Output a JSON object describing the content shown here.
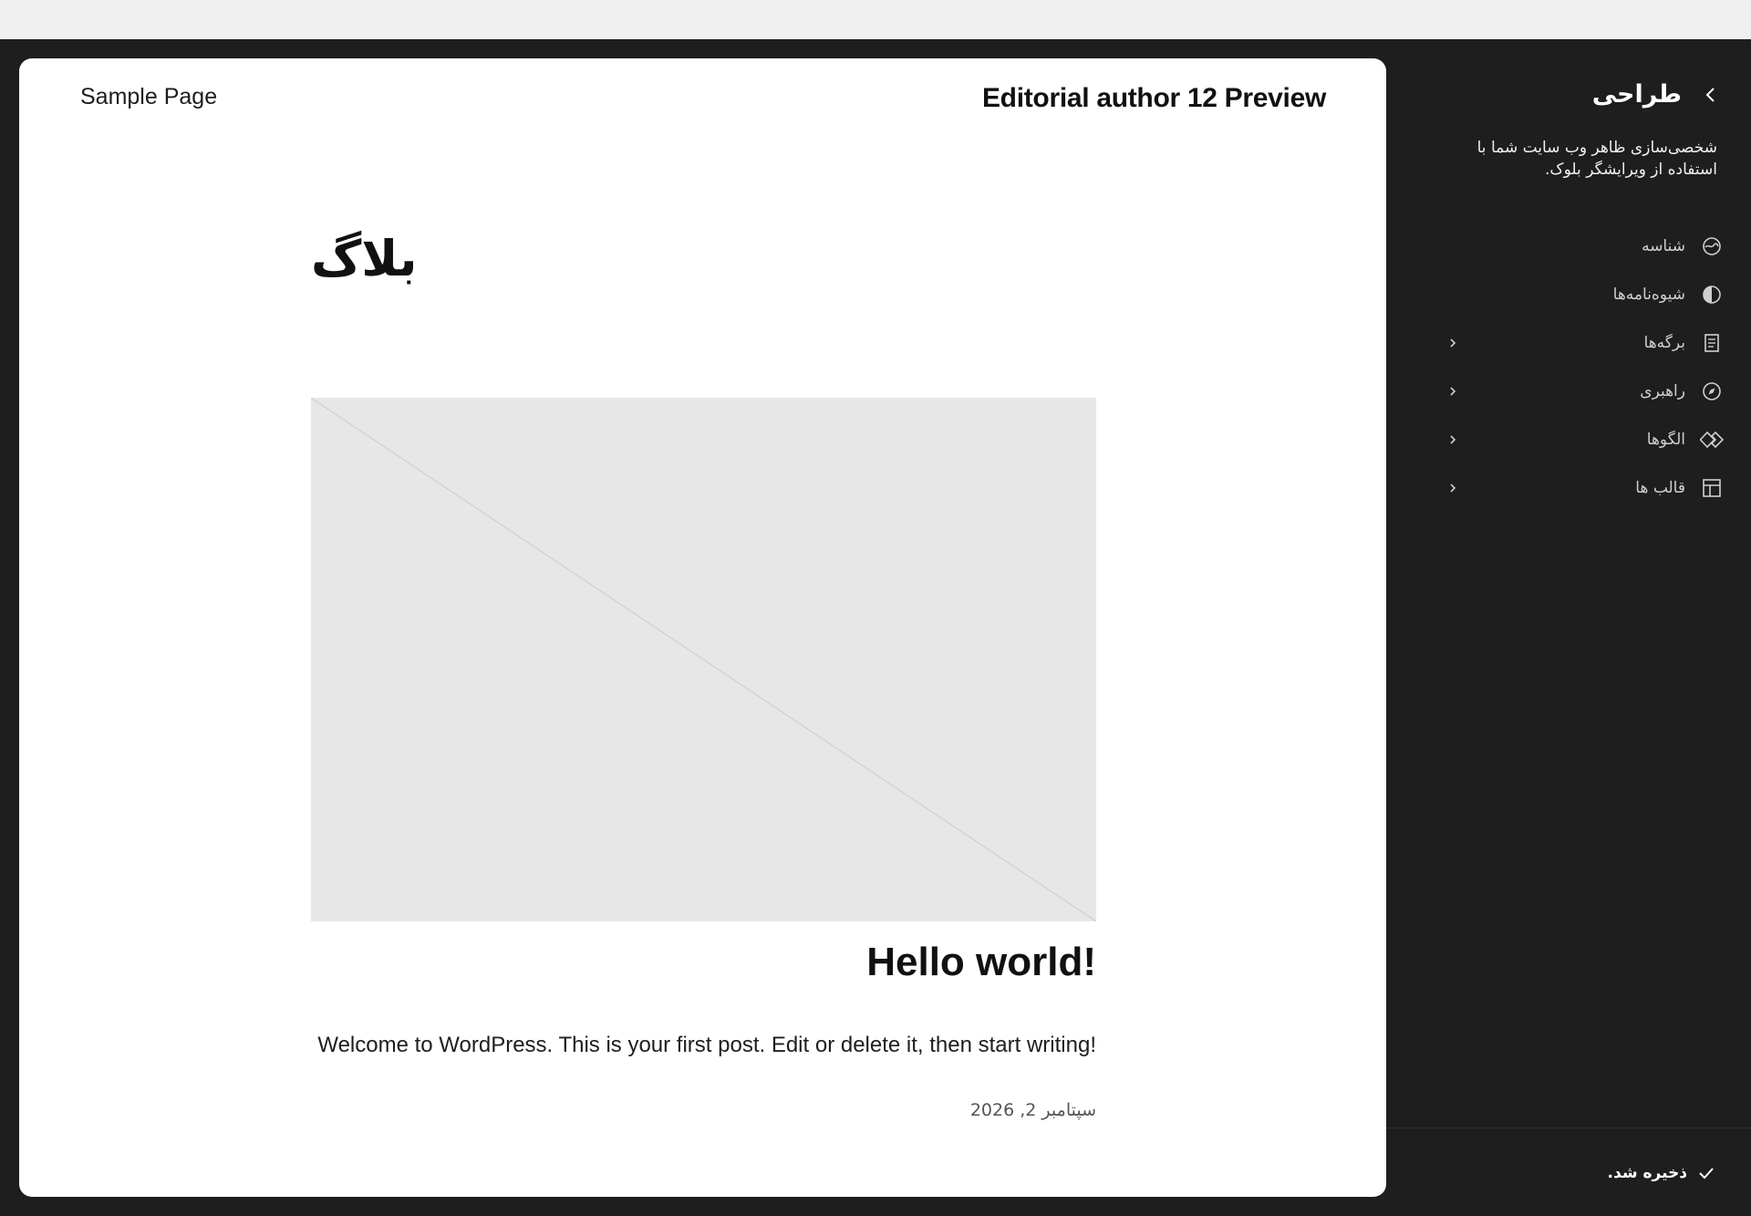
{
  "preview": {
    "nav_link": "Sample Page",
    "site_title": "Editorial author 12 Preview",
    "blog_heading": "بلاگ",
    "post": {
      "title": "Hello world!",
      "excerpt": "Welcome to WordPress. This is your first post. Edit or delete it, then start writing!",
      "date": "سپتامبر 2, 2026"
    }
  },
  "sidebar": {
    "title": "طراحی",
    "description": "شخصی‌سازی ظاهر وب سایت شما با استفاده از ویرایشگر بلوک.",
    "items": [
      {
        "label": "شناسه",
        "icon": "identity-icon",
        "has_chevron": false
      },
      {
        "label": "شیوه‌نامه‌ها",
        "icon": "styles-icon",
        "has_chevron": false
      },
      {
        "label": "برگه‌ها",
        "icon": "pages-icon",
        "has_chevron": true
      },
      {
        "label": "راهبری",
        "icon": "navigation-icon",
        "has_chevron": true
      },
      {
        "label": "الگوها",
        "icon": "patterns-icon",
        "has_chevron": true
      },
      {
        "label": "قالب ها",
        "icon": "templates-icon",
        "has_chevron": true
      }
    ],
    "save_status": "ذخیره شد."
  }
}
